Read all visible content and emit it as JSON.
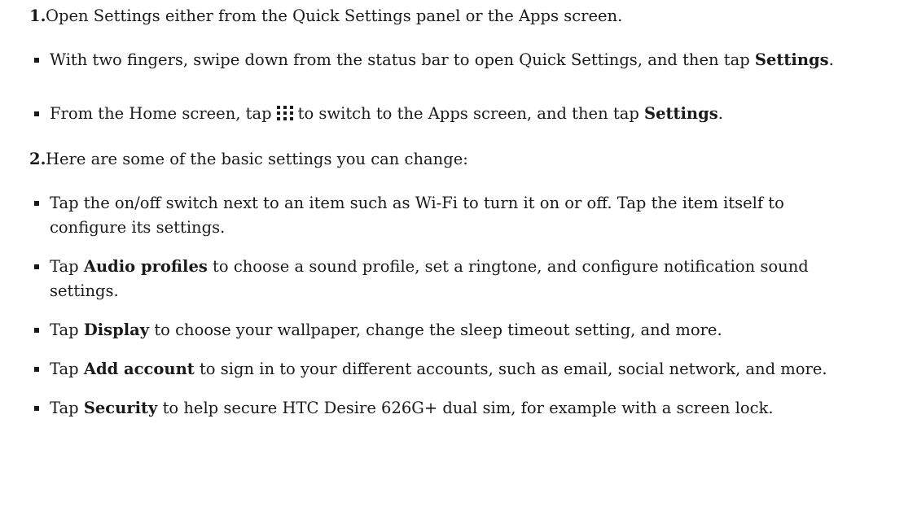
{
  "step1": {
    "number": "1.",
    "text": "Open Settings either from the Quick Settings panel or the Apps screen.",
    "items": [
      {
        "pre": "With two fingers, swipe down from the status bar to open Quick Settings, and then tap ",
        "bold": "Settings",
        "post": "."
      },
      {
        "pre": "From the Home screen, tap",
        "icon": "apps-grid-icon",
        "mid": "to switch to the Apps screen, and then tap ",
        "bold": "Settings",
        "post": "."
      }
    ]
  },
  "step2": {
    "number": "2.",
    "text": "Here are some of the basic settings you can change:",
    "items": [
      {
        "pre": "Tap the on/off switch next to an item such as Wi-Fi to turn it on or off. Tap the item itself to configure its settings."
      },
      {
        "pre": "Tap ",
        "bold": "Audio profiles",
        "post": " to choose a sound profile, set a ringtone, and configure notification sound settings."
      },
      {
        "pre": "Tap ",
        "bold": "Display",
        "post": " to choose your wallpaper, change the sleep timeout setting, and more."
      },
      {
        "pre": "Tap ",
        "bold": "Add account",
        "post": " to sign in to your different accounts, such as email, social network, and more."
      },
      {
        "pre": "Tap ",
        "bold": "Security",
        "post": " to help secure HTC Desire 626G+ dual sim, for example with a screen lock."
      }
    ]
  }
}
